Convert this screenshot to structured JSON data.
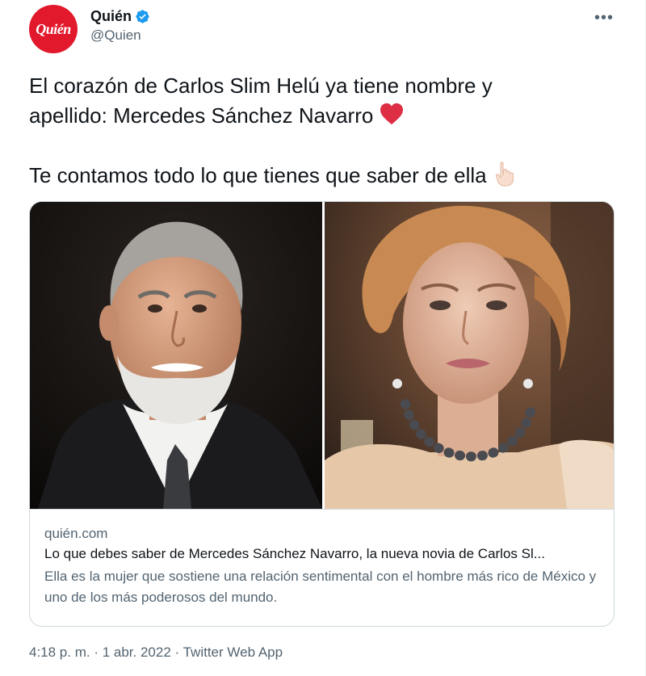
{
  "author": {
    "avatar_text": "Quién",
    "display_name": "Quién",
    "handle": "@Quien",
    "verified": true
  },
  "menu": {
    "more_icon": "•••"
  },
  "tweet": {
    "line1": "El corazón de Carlos Slim Helú ya tiene nombre y",
    "line2": "apellido: Mercedes Sánchez Navarro",
    "line3": "Te contamos todo lo que tienes que saber de ella"
  },
  "card": {
    "domain": "quién.com",
    "title": "Lo que debes saber de Mercedes Sánchez Navarro, la nueva novia de Carlos Sl...",
    "description": "Ella es la mujer que sostiene una relación sentimental con el hombre más rico de México y uno de los más poderosos del mundo."
  },
  "footer": {
    "time": "4:18 p. m.",
    "separator1": " · ",
    "date": "1 abr. 2022",
    "separator2": " · ",
    "app": "Twitter Web App"
  },
  "colors": {
    "brand_red": "#e2192c",
    "verified_blue": "#1d9bf0",
    "secondary_text": "#536471",
    "primary_text": "#0f1419"
  },
  "icons": {
    "verified": "verified-badge-icon",
    "heart": "red-heart-icon",
    "finger": "pointing-down-icon",
    "more": "more-dots-icon"
  }
}
